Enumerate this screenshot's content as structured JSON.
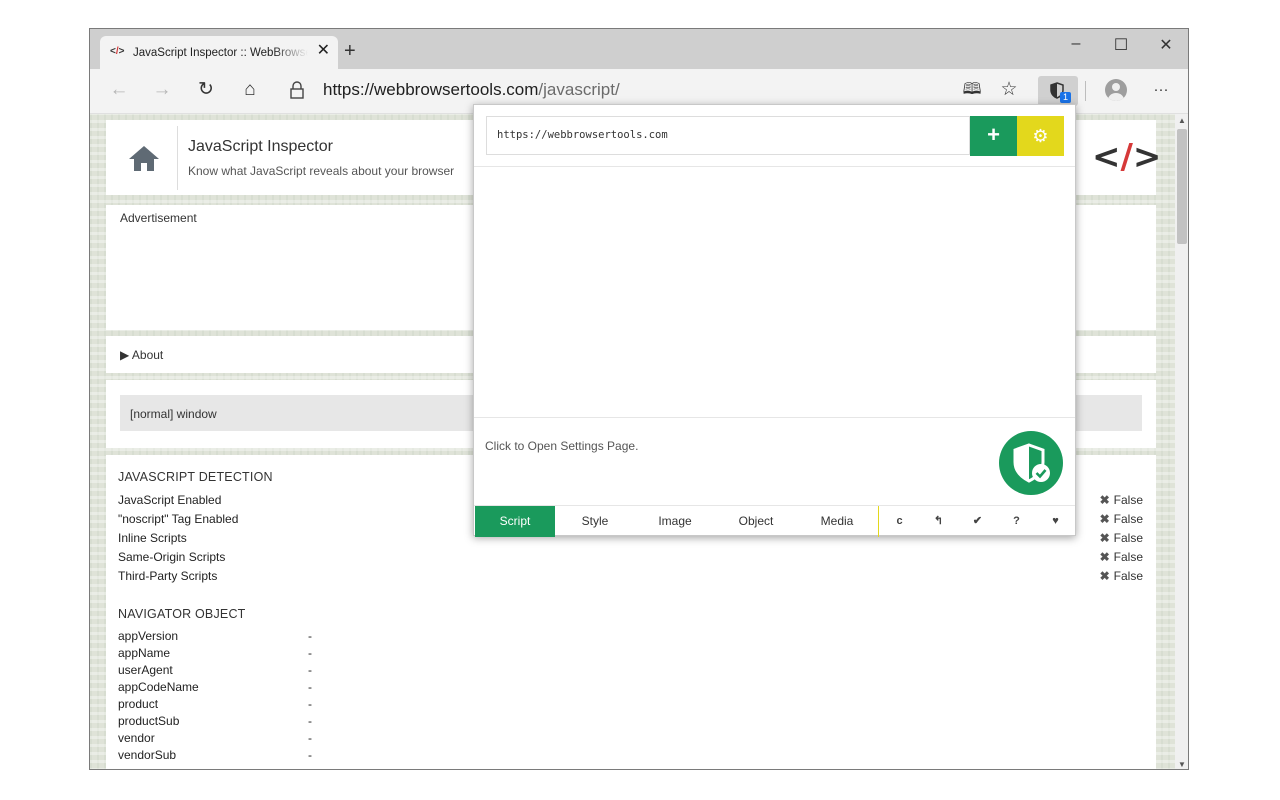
{
  "browser": {
    "tab_title": "JavaScript Inspector :: WebBrowserTools",
    "tab_favicon_left": "<",
    "tab_favicon_slash": "/",
    "tab_favicon_right": ">",
    "close_tab": "✕",
    "new_tab": "+",
    "minimize": "–",
    "maximize": "☐",
    "close_window": "✕",
    "url_host": "https://webbrowsertools.com",
    "url_path": "/javascript/",
    "ext_badge": "1",
    "back": "←",
    "forward": "→",
    "refresh": "↻",
    "home": "⌂",
    "read_aloud": "🕮",
    "favorite": "☆",
    "more": "···"
  },
  "site": {
    "title": "JavaScript Inspector",
    "subtitle": "Know what JavaScript reveals about your browser",
    "logo_left": "<",
    "logo_slash": "/",
    "logo_right": ">",
    "ad_label": "Advertisement",
    "about_label": "▶  About",
    "mode_label": "[normal] window",
    "detection": {
      "title": "JAVASCRIPT DETECTION",
      "rows": [
        {
          "label": "JavaScript Enabled",
          "value": "False",
          "mark": "✖"
        },
        {
          "label": "\"noscript\" Tag Enabled",
          "value": "False",
          "mark": "✖"
        },
        {
          "label": "Inline Scripts",
          "value": "False",
          "mark": "✖"
        },
        {
          "label": "Same-Origin Scripts",
          "value": "False",
          "mark": "✖"
        },
        {
          "label": "Third-Party Scripts",
          "value": "False",
          "mark": "✖"
        }
      ]
    },
    "navigator": {
      "title": "NAVIGATOR OBJECT",
      "rows": [
        {
          "label": "appVersion",
          "value": "-"
        },
        {
          "label": "appName",
          "value": "-"
        },
        {
          "label": "userAgent",
          "value": "-"
        },
        {
          "label": "appCodeName",
          "value": "-"
        },
        {
          "label": "product",
          "value": "-"
        },
        {
          "label": "productSub",
          "value": "-"
        },
        {
          "label": "vendor",
          "value": "-"
        },
        {
          "label": "vendorSub",
          "value": "-"
        }
      ]
    }
  },
  "popup": {
    "url_value": "https://webbrowsertools.com",
    "add": "+",
    "settings_icon": "⚙",
    "settings_link": "Click to Open Settings Page.",
    "tabs": [
      "Script",
      "Style",
      "Image",
      "Object",
      "Media"
    ],
    "actions": [
      "c",
      "↰",
      "✔",
      "?",
      "♥"
    ]
  },
  "colors": {
    "accent_green": "#1a9a5c",
    "accent_yellow": "#e3d81c",
    "logo_red": "#d63939"
  }
}
